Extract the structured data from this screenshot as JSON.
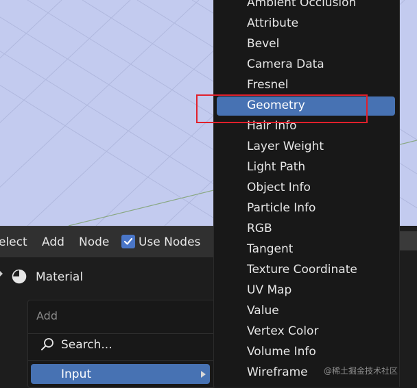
{
  "header": {
    "select_label": "elect",
    "add_label": "Add",
    "node_label": "Node",
    "use_nodes_label": "Use Nodes"
  },
  "material": {
    "label": "Material"
  },
  "add_menu": {
    "title": "Add",
    "search_label": "Search...",
    "input_label": "Input"
  },
  "input_submenu": {
    "items": [
      "Ambient Occlusion",
      "Attribute",
      "Bevel",
      "Camera Data",
      "Fresnel",
      "Geometry",
      "Hair Info",
      "Layer Weight",
      "Light Path",
      "Object Info",
      "Particle Info",
      "RGB",
      "Tangent",
      "Texture Coordinate",
      "UV Map",
      "Value",
      "Vertex Color",
      "Volume Info",
      "Wireframe"
    ],
    "active": "Geometry"
  },
  "watermark": "@稀土掘金技术社区",
  "colors": {
    "accent": "#4772b3",
    "highlight_box": "#e0202c",
    "viewport_bg": "#c3cbef",
    "menu_bg": "#181818"
  },
  "icons": {
    "material": "material-sphere-icon",
    "search": "search-icon",
    "checkbox": "checkmark-icon",
    "submenu": "submenu-arrow-icon"
  }
}
